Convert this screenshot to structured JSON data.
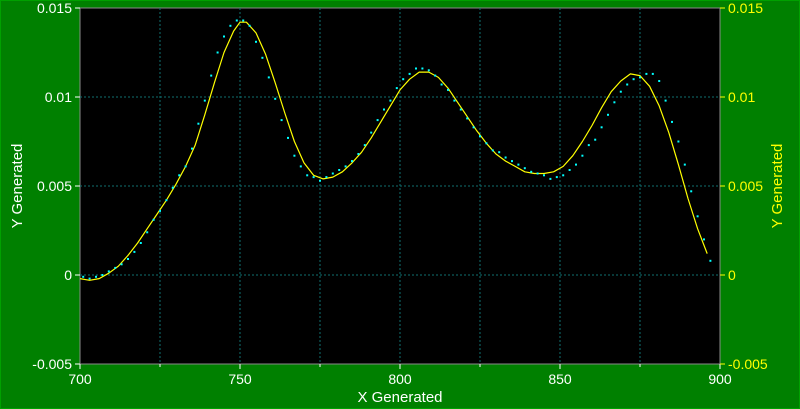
{
  "chart_data": {
    "type": "scatter",
    "xlabel": "X Generated",
    "ylabel_left": "Y Generated",
    "ylabel_right": "Y Generated",
    "xlim": [
      700,
      900
    ],
    "ylim": [
      -0.005,
      0.015
    ],
    "x_ticks": [
      "700",
      "750",
      "800",
      "850",
      "900"
    ],
    "y_ticks": [
      "-0.005",
      "0",
      "0.005",
      "0.01",
      "0.015"
    ],
    "x_minor_step": 25,
    "grid": true,
    "colors": {
      "background": "#008000",
      "plot_area": "#000000",
      "fit_line": "#ffff00",
      "points": "#00ffff",
      "grid": "#0f6f6f",
      "left_axis_text": "#ffffff",
      "right_axis_text": "#ffff00"
    },
    "series": [
      {
        "kind": "points",
        "x": [
          701,
          703,
          705,
          707,
          709,
          711,
          713,
          715,
          717,
          719,
          721,
          723,
          725,
          727,
          729,
          731,
          733,
          735,
          737,
          739,
          741,
          743,
          745,
          747,
          749,
          751,
          753,
          755,
          757,
          759,
          761,
          763,
          765,
          767,
          769,
          771,
          773,
          775,
          777,
          779,
          781,
          783,
          785,
          787,
          789,
          791,
          793,
          795,
          797,
          799,
          801,
          803,
          805,
          807,
          809,
          811,
          813,
          815,
          817,
          819,
          821,
          823,
          825,
          827,
          829,
          831,
          833,
          835,
          837,
          839,
          841,
          843,
          845,
          847,
          849,
          851,
          853,
          855,
          857,
          859,
          861,
          863,
          865,
          867,
          869,
          871,
          873,
          875,
          877,
          879,
          881,
          883,
          885,
          887,
          889,
          891,
          893,
          895,
          897
        ],
        "y": [
          -0.0001,
          -0.0002,
          -0.0001,
          0.0,
          0.0002,
          0.0004,
          0.0006,
          0.0009,
          0.0013,
          0.0018,
          0.0024,
          0.0031,
          0.0036,
          0.0042,
          0.0049,
          0.0056,
          0.0061,
          0.0071,
          0.0085,
          0.0098,
          0.0112,
          0.0125,
          0.0134,
          0.014,
          0.0143,
          0.0143,
          0.014,
          0.0131,
          0.0122,
          0.0111,
          0.0099,
          0.0087,
          0.0077,
          0.0067,
          0.0061,
          0.0056,
          0.0055,
          0.0053,
          0.0055,
          0.0057,
          0.0059,
          0.0061,
          0.0064,
          0.0068,
          0.0073,
          0.008,
          0.0087,
          0.0093,
          0.0098,
          0.0105,
          0.011,
          0.0113,
          0.0116,
          0.0116,
          0.0115,
          0.0112,
          0.0107,
          0.0104,
          0.0098,
          0.0093,
          0.0088,
          0.0083,
          0.0078,
          0.0074,
          0.007,
          0.0069,
          0.0066,
          0.0064,
          0.0062,
          0.006,
          0.0058,
          0.0057,
          0.0056,
          0.0054,
          0.0055,
          0.0056,
          0.0059,
          0.0062,
          0.0067,
          0.0073,
          0.0076,
          0.0083,
          0.009,
          0.0097,
          0.0103,
          0.0107,
          0.011,
          0.0111,
          0.0113,
          0.0113,
          0.0109,
          0.0098,
          0.0086,
          0.0075,
          0.0062,
          0.0047,
          0.0033,
          0.002,
          0.0008
        ]
      },
      {
        "kind": "fit_line",
        "x": [
          700,
          703,
          706,
          709,
          712,
          715,
          718,
          721,
          724,
          727,
          730,
          733,
          736,
          739,
          742,
          745,
          748,
          750,
          752,
          755,
          758,
          761,
          764,
          767,
          770,
          773,
          776,
          779,
          782,
          785,
          788,
          791,
          794,
          797,
          800,
          803,
          806,
          809,
          812,
          815,
          818,
          821,
          824,
          827,
          830,
          833,
          836,
          839,
          842,
          845,
          848,
          851,
          854,
          857,
          860,
          863,
          866,
          869,
          872,
          875,
          878,
          881,
          884,
          887,
          890,
          893,
          896
        ],
        "y": [
          -0.0002,
          -0.0003,
          -0.0002,
          0.0001,
          0.0005,
          0.0011,
          0.0018,
          0.0026,
          0.0034,
          0.0042,
          0.0051,
          0.0061,
          0.0073,
          0.009,
          0.0108,
          0.0125,
          0.0137,
          0.0142,
          0.0142,
          0.0136,
          0.0124,
          0.0108,
          0.0091,
          0.0075,
          0.0063,
          0.0056,
          0.0054,
          0.0055,
          0.0058,
          0.0063,
          0.0069,
          0.0077,
          0.0086,
          0.0095,
          0.0104,
          0.011,
          0.0114,
          0.0114,
          0.0111,
          0.0105,
          0.0097,
          0.0089,
          0.0081,
          0.0074,
          0.0068,
          0.0064,
          0.0061,
          0.0058,
          0.0057,
          0.0057,
          0.0058,
          0.0061,
          0.0067,
          0.0075,
          0.0084,
          0.0094,
          0.0103,
          0.0109,
          0.0113,
          0.0112,
          0.0106,
          0.0095,
          0.008,
          0.0062,
          0.0043,
          0.0026,
          0.0012
        ]
      }
    ]
  }
}
